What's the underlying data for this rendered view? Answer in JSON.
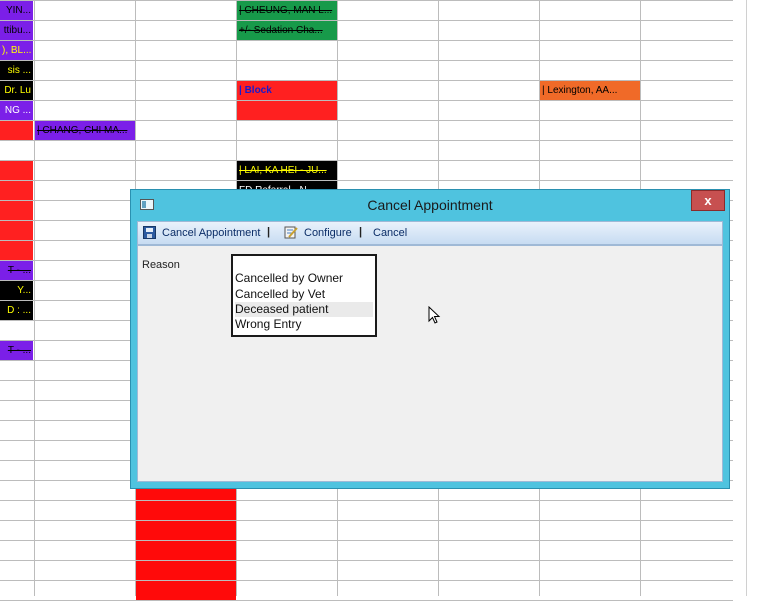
{
  "schedule": {
    "appointments": [
      {
        "col": 0,
        "row": 0,
        "text": "YIN...",
        "bg": "#7b1fe8",
        "fg": "#000000",
        "strike": false
      },
      {
        "col": 0,
        "row": 1,
        "text": "ttibu...",
        "bg": "#7b1fe8",
        "fg": "#000000",
        "strike": false
      },
      {
        "col": 0,
        "row": 2,
        "text": "), BL...",
        "bg": "#7b1fe8",
        "fg": "#ffff00",
        "strike": false
      },
      {
        "col": 0,
        "row": 3,
        "text": "sis ...",
        "bg": "#000000",
        "fg": "#ffff00",
        "strike": false
      },
      {
        "col": 0,
        "row": 4,
        "text": "Dr. Lu",
        "bg": "#000000",
        "fg": "#ffff00",
        "strike": false
      },
      {
        "col": 0,
        "row": 5,
        "text": "NG ...",
        "bg": "#7b1fe8",
        "fg": "#ffffff",
        "strike": false
      },
      {
        "col": 0,
        "row": 6,
        "text": "",
        "bg": "#ff2020",
        "fg": "#000000",
        "strike": false
      },
      {
        "col": 0,
        "row": 7,
        "text": "",
        "bg": "#ffffff",
        "fg": "#000000",
        "strike": false
      },
      {
        "col": 0,
        "row": 8,
        "text": "",
        "bg": "#ff2020",
        "fg": "#000000",
        "strike": false
      },
      {
        "col": 0,
        "row": 9,
        "text": "",
        "bg": "#ff2020",
        "fg": "#000000",
        "strike": false
      },
      {
        "col": 0,
        "row": 10,
        "text": "",
        "bg": "#ff2020",
        "fg": "#000000",
        "strike": false
      },
      {
        "col": 0,
        "row": 11,
        "text": "",
        "bg": "#ff2020",
        "fg": "#000000",
        "strike": false
      },
      {
        "col": 0,
        "row": 12,
        "text": "",
        "bg": "#ff2020",
        "fg": "#000000",
        "strike": false
      },
      {
        "col": 0,
        "row": 13,
        "text": "T - ...",
        "bg": "#7b1fe8",
        "fg": "#000000",
        "strike": true
      },
      {
        "col": 0,
        "row": 14,
        "text": "Y...",
        "bg": "#000000",
        "fg": "#ffff00",
        "strike": false
      },
      {
        "col": 0,
        "row": 15,
        "text": "D : ...",
        "bg": "#000000",
        "fg": "#ffff00",
        "strike": false
      },
      {
        "col": 0,
        "row": 17,
        "text": "T - ...",
        "bg": "#7b1fe8",
        "fg": "#000000",
        "strike": true
      },
      {
        "col": 1,
        "row": 6,
        "text": "| CHANG, CHI MA...",
        "bg": "#7b1fe8",
        "fg": "#000000",
        "strike": true
      },
      {
        "col": 3,
        "row": 0,
        "text": "| CHEUNG, MAN L...",
        "bg": "#179a4a",
        "fg": "#000000",
        "strike": true
      },
      {
        "col": 3,
        "row": 1,
        "text": "+/-  Sedation Cha...",
        "bg": "#179a4a",
        "fg": "#000000",
        "strike": true
      },
      {
        "col": 3,
        "row": 4,
        "text": "| Block",
        "bg": "#ff2020",
        "fg": "#1a1acc",
        "strike": false
      },
      {
        "col": 3,
        "row": 5,
        "text": "",
        "bg": "#ff2020",
        "fg": "#000000",
        "strike": false
      },
      {
        "col": 3,
        "row": 8,
        "text": "| LAI, KA HEI - JU...",
        "bg": "#000000",
        "fg": "#ffff00",
        "strike": true
      },
      {
        "col": 3,
        "row": 9,
        "text": "FD Referral - N...",
        "bg": "#000000",
        "fg": "#ffffff",
        "strike": false
      },
      {
        "col": 6,
        "row": 4,
        "text": "| Lexington, AA...",
        "bg": "#f06a28",
        "fg": "#000000",
        "strike": false
      },
      {
        "col": 2,
        "row": 24,
        "text": "",
        "bg": "#ff0a0a",
        "fg": "#000000",
        "strike": false
      },
      {
        "col": 2,
        "row": 25,
        "text": "",
        "bg": "#ff0a0a",
        "fg": "#000000",
        "strike": false
      },
      {
        "col": 2,
        "row": 26,
        "text": "",
        "bg": "#ff0a0a",
        "fg": "#000000",
        "strike": false
      },
      {
        "col": 2,
        "row": 27,
        "text": "",
        "bg": "#ff0a0a",
        "fg": "#000000",
        "strike": false
      },
      {
        "col": 2,
        "row": 28,
        "text": "",
        "bg": "#ff0a0a",
        "fg": "#000000",
        "strike": false
      },
      {
        "col": 2,
        "row": 29,
        "text": "",
        "bg": "#ff0a0a",
        "fg": "#000000",
        "strike": false
      }
    ]
  },
  "dialog": {
    "title": "Cancel Appointment",
    "close_label": "x",
    "toolbar": {
      "cancel_appointment_label": "Cancel Appointment",
      "sep": "|",
      "configure_label": "Configure",
      "cancel_label": "Cancel"
    },
    "reason_label": "Reason",
    "reason_options": [
      "Cancelled by Owner",
      "Cancelled by Vet",
      "Deceased patient",
      "Wrong Entry"
    ],
    "hovered_option": "Deceased patient"
  }
}
